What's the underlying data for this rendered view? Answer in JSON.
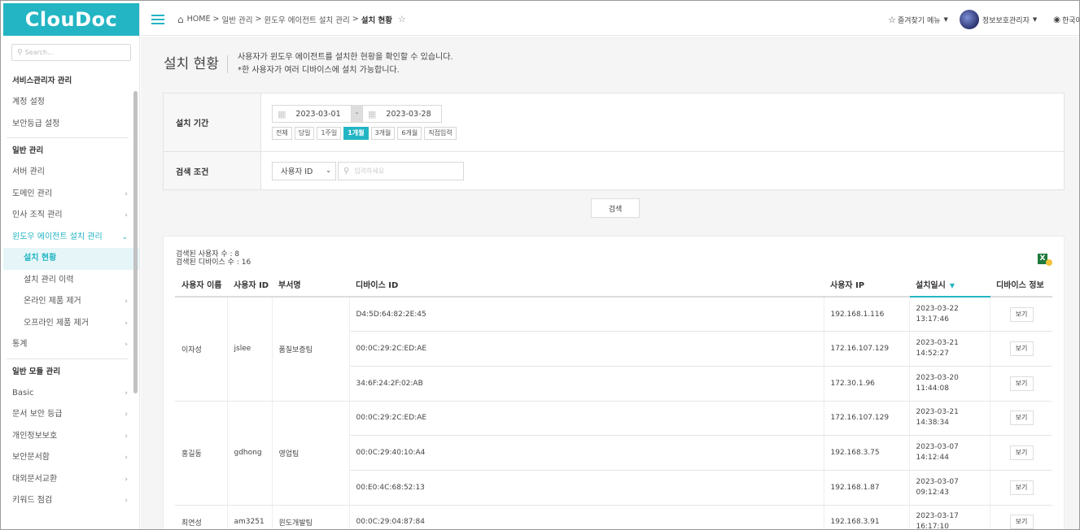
{
  "app": {
    "logo": "ClouDoc"
  },
  "sidebar": {
    "search_placeholder": "Search...",
    "groups": [
      {
        "title": "서비스관리자 관리",
        "items": [
          {
            "label": "계정 설정"
          },
          {
            "label": "보안등급 설정"
          }
        ]
      },
      {
        "title": "일반 관리",
        "items": [
          {
            "label": "서버 관리"
          },
          {
            "label": "도메인 관리"
          },
          {
            "label": "인사 조직 관리"
          },
          {
            "label": "윈도우 에이전트 설치 관리"
          },
          {
            "label": "설치 현황"
          },
          {
            "label": "설치 관리 이력"
          },
          {
            "label": "온라인 제품 제거"
          },
          {
            "label": "오프라인 제품 제거"
          },
          {
            "label": "통계"
          }
        ]
      },
      {
        "title": "일반 모듈 관리",
        "items": [
          {
            "label": "Basic"
          },
          {
            "label": "문서 보안 등급"
          },
          {
            "label": "개인정보보호"
          },
          {
            "label": "보안문서함"
          },
          {
            "label": "대외문서교환"
          },
          {
            "label": "키워드 점검"
          }
        ]
      }
    ]
  },
  "header": {
    "breadcrumb": {
      "home": "HOME",
      "b1": "일반 관리",
      "b2": "윈도우 에이전트 설치 관리",
      "current": "설치 현황",
      "sep": ">"
    },
    "favorites": "즐겨찾기 메뉴",
    "user": "정보보호관리자",
    "lang": "한국어"
  },
  "page": {
    "title": "설치 현황",
    "desc1": "사용자가 윈도우 에이전트를 설치한 현황을 확인할 수 있습니다.",
    "desc2": "*한 사용자가 여러 디바이스에 설치 가능합니다."
  },
  "filter": {
    "period_label": "설치 기간",
    "date_from": "2023-03-01",
    "date_sep": "-",
    "date_to": "2023-03-28",
    "period_buttons": [
      "전체",
      "당일",
      "1주일",
      "1개월",
      "3개월",
      "6개월",
      "직접입력"
    ],
    "active_period": "1개월",
    "cond_label": "검색 조건",
    "cond_select": "사용자 ID",
    "keyword_placeholder": "입력하세요"
  },
  "search_button": "검색",
  "results": {
    "user_count": "검색된 사용자 수 : 8",
    "device_count": "검색된 디바이스 수 : 16",
    "headers": {
      "name": "사용자 이름",
      "id": "사용자 ID",
      "dept": "부서명",
      "device": "디바이스 ID",
      "ip": "사용자 IP",
      "date": "설치일시",
      "info": "디바이스 정보"
    },
    "view_label": "보기",
    "users": [
      {
        "name": "이자성",
        "id": "jslee",
        "dept": "품질보증팀",
        "devices": [
          {
            "device": "D4:5D:64:82:2E:45",
            "ip": "192.168.1.116",
            "date": "2023-03-22",
            "time": "13:17:46"
          },
          {
            "device": "00:0C:29:2C:ED:AE",
            "ip": "172.16.107.129",
            "date": "2023-03-21",
            "time": "14:52:27"
          },
          {
            "device": "34:6F:24:2F:02:AB",
            "ip": "172.30.1.96",
            "date": "2023-03-20",
            "time": "11:44:08"
          }
        ]
      },
      {
        "name": "홍길동",
        "id": "gdhong",
        "dept": "영업팀",
        "devices": [
          {
            "device": "00:0C:29:2C:ED:AE",
            "ip": "172.16.107.129",
            "date": "2023-03-21",
            "time": "14:38:34"
          },
          {
            "device": "00:0C:29:40:10:A4",
            "ip": "192.168.3.75",
            "date": "2023-03-07",
            "time": "14:12:44"
          },
          {
            "device": "00:E0:4C:68:52:13",
            "ip": "192.168.1.87",
            "date": "2023-03-07",
            "time": "09:12:43"
          }
        ]
      },
      {
        "name": "최연성",
        "id": "am3251",
        "dept": "윈도개발팀",
        "devices": [
          {
            "device": "00:0C:29:04:87:84",
            "ip": "192.168.3.91",
            "date": "2023-03-17",
            "time": "16:17:10"
          }
        ]
      }
    ]
  }
}
